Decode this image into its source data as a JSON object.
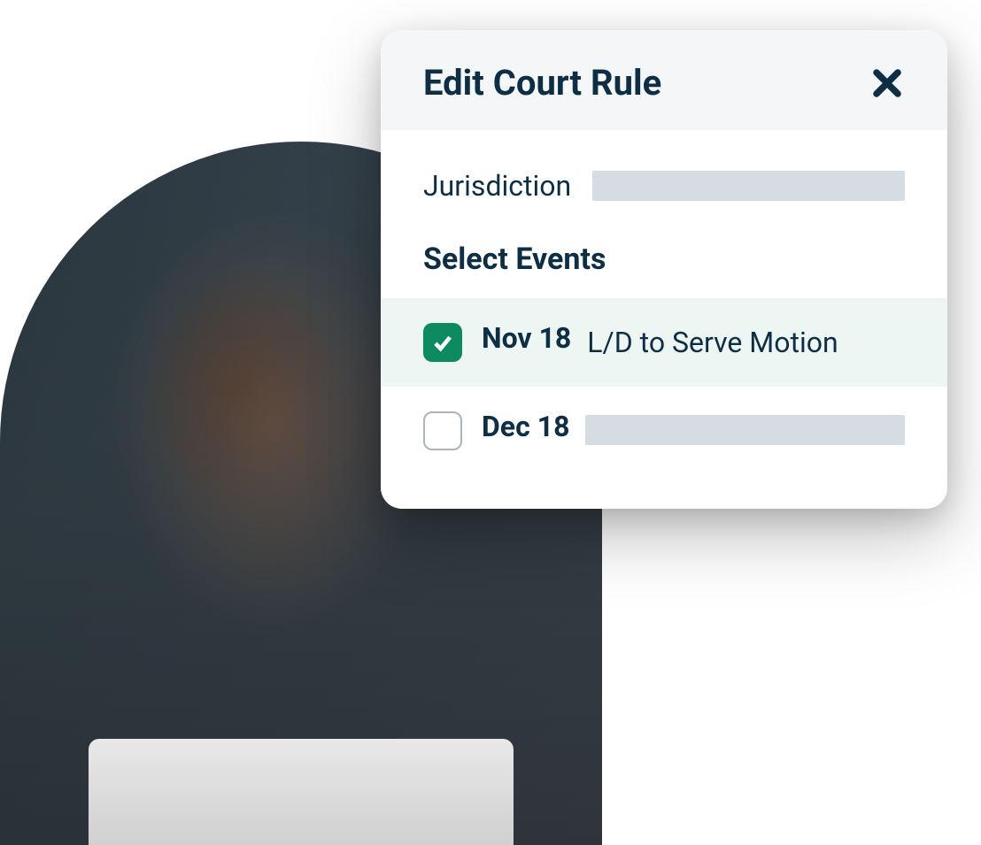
{
  "modal": {
    "title": "Edit Court Rule",
    "jurisdiction_label": "Jurisdiction",
    "section_title": "Select Events",
    "events": [
      {
        "date": "Nov 18",
        "description": "L/D to Serve Motion",
        "checked": true
      },
      {
        "date": "Dec 18",
        "description": "",
        "checked": false
      }
    ]
  },
  "colors": {
    "primary_text": "#0d2e45",
    "checkbox_checked": "#0d8a5f",
    "placeholder": "#d5dde2",
    "selected_row": "#eef6f4",
    "header_bg": "#f5f6f7"
  }
}
